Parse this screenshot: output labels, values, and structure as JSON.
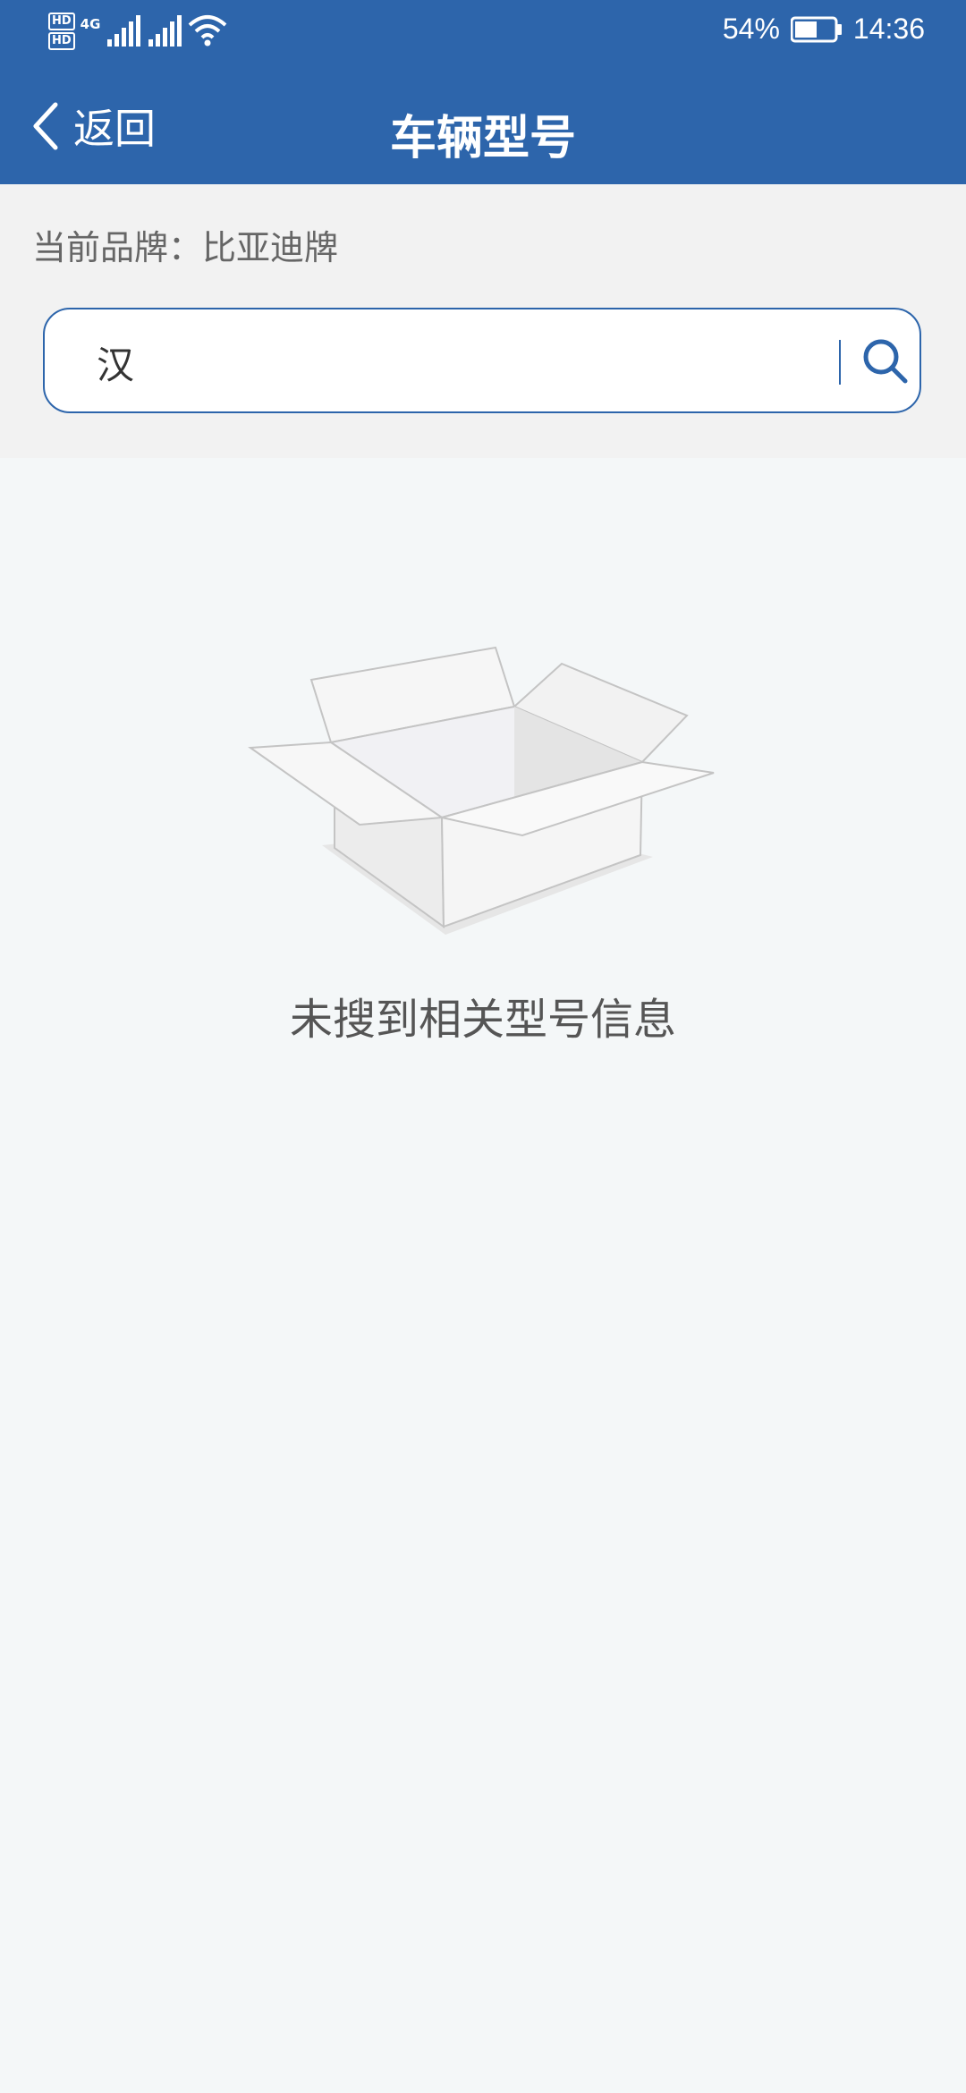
{
  "status_bar": {
    "hd1": "HD",
    "hd2": "HD",
    "network": "4G",
    "battery": "54%",
    "time": "14:36"
  },
  "nav": {
    "back_label": "返回",
    "title": "车辆型号"
  },
  "brand": {
    "text": "当前品牌：比亚迪牌"
  },
  "search": {
    "value": "汉",
    "placeholder": ""
  },
  "empty": {
    "message": "未搜到相关型号信息"
  },
  "colors": {
    "header_bg": "#2d65ab",
    "panel_bg": "#f2f2f2",
    "page_bg": "#f4f7f8"
  }
}
